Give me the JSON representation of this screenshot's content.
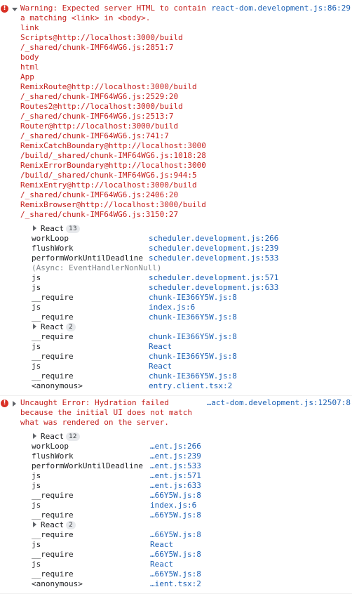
{
  "messages": [
    {
      "type": "warning-error",
      "source": "react-dom.development.js:86:29",
      "text_lines": [
        "Warning: Expected server HTML to contain",
        "a matching <link> in <body>.",
        "link",
        "Scripts@http://localhost:3000/build",
        "/_shared/chunk-IMF64WG6.js:2851:7",
        "body",
        "html",
        "App",
        "RemixRoute@http://localhost:3000/build",
        "/_shared/chunk-IMF64WG6.js:2529:20",
        "Routes2@http://localhost:3000/build",
        "/_shared/chunk-IMF64WG6.js:2513:7",
        "Router@http://localhost:3000/build",
        "/_shared/chunk-IMF64WG6.js:741:7",
        "RemixCatchBoundary@http://localhost:3000",
        "/build/_shared/chunk-IMF64WG6.js:1018:28",
        "RemixErrorBoundary@http://localhost:3000",
        "/build/_shared/chunk-IMF64WG6.js:944:5",
        "RemixEntry@http://localhost:3000/build",
        "/_shared/chunk-IMF64WG6.js:2406:20",
        "RemixBrowser@http://localhost:3000/build",
        "/_shared/chunk-IMF64WG6.js:3150:27"
      ],
      "react_group": {
        "label": "React",
        "count": "13"
      },
      "frames": [
        {
          "fn": "workLoop",
          "loc": "scheduler.development.js:266"
        },
        {
          "fn": "flushWork",
          "loc": "scheduler.development.js:239"
        },
        {
          "fn": "performWorkUntilDeadline",
          "loc": "scheduler.development.js:533"
        },
        {
          "async": "(Async: EventHandlerNonNull)"
        },
        {
          "fn": "js",
          "loc": "scheduler.development.js:571"
        },
        {
          "fn": "js",
          "loc": "scheduler.development.js:633"
        },
        {
          "fn": "__require",
          "loc": "chunk-IE366Y5W.js:8"
        },
        {
          "fn": "js",
          "loc": "index.js:6"
        },
        {
          "fn": "__require",
          "loc": "chunk-IE366Y5W.js:8"
        },
        {
          "group": "React",
          "count": "2"
        },
        {
          "fn": "__require",
          "loc": "chunk-IE366Y5W.js:8"
        },
        {
          "fn": "js",
          "loc": "React"
        },
        {
          "fn": "__require",
          "loc": "chunk-IE366Y5W.js:8"
        },
        {
          "fn": "js",
          "loc": "React"
        },
        {
          "fn": "__require",
          "loc": "chunk-IE366Y5W.js:8"
        },
        {
          "fn": "<anonymous>",
          "loc": "entry.client.tsx:2"
        }
      ]
    },
    {
      "type": "error",
      "source": "…act-dom.development.js:12507:8",
      "text_lines": [
        "Uncaught Error: Hydration failed",
        "because the initial UI does not match",
        "what was rendered on the server."
      ],
      "react_group": {
        "label": "React",
        "count": "12"
      },
      "frames": [
        {
          "fn": "workLoop",
          "loc": "…ent.js:266"
        },
        {
          "fn": "flushWork",
          "loc": "…ent.js:239"
        },
        {
          "fn": "performWorkUntilDeadline",
          "loc": "…ent.js:533"
        },
        {
          "fn": "js",
          "loc": "…ent.js:571"
        },
        {
          "fn": "js",
          "loc": "…ent.js:633"
        },
        {
          "fn": "__require",
          "loc": "…66Y5W.js:8"
        },
        {
          "fn": "js",
          "loc": "index.js:6"
        },
        {
          "fn": "__require",
          "loc": "…66Y5W.js:8"
        },
        {
          "group": "React",
          "count": "2"
        },
        {
          "fn": "__require",
          "loc": "…66Y5W.js:8"
        },
        {
          "fn": "js",
          "loc": "React"
        },
        {
          "fn": "__require",
          "loc": "…66Y5W.js:8"
        },
        {
          "fn": "js",
          "loc": "React"
        },
        {
          "fn": "__require",
          "loc": "…66Y5W.js:8"
        },
        {
          "fn": "<anonymous>",
          "loc": "…ient.tsx:2"
        }
      ]
    }
  ]
}
